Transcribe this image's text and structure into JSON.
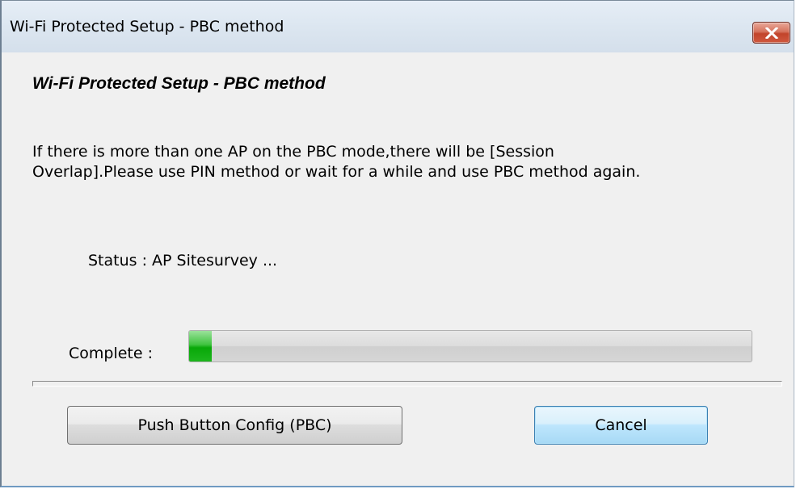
{
  "window": {
    "title": "Wi-Fi Protected Setup - PBC method",
    "close_icon": "close-icon"
  },
  "main": {
    "heading": "Wi-Fi Protected Setup - PBC method",
    "description_line1": "If there is more than one AP on the PBC mode,there will be [Session",
    "description_line2": "Overlap].Please use PIN method or wait for a while and use PBC method again.",
    "status": "Status : AP Sitesurvey ...",
    "complete_label": "Complete :",
    "progress": {
      "value_percent": 4,
      "fill_color": "#08a808"
    }
  },
  "buttons": {
    "pbc_label": "Push Button Config (PBC)",
    "cancel_label": "Cancel"
  },
  "colors": {
    "close_button": "#c2442b",
    "default_button_border": "#3c7fb1"
  }
}
